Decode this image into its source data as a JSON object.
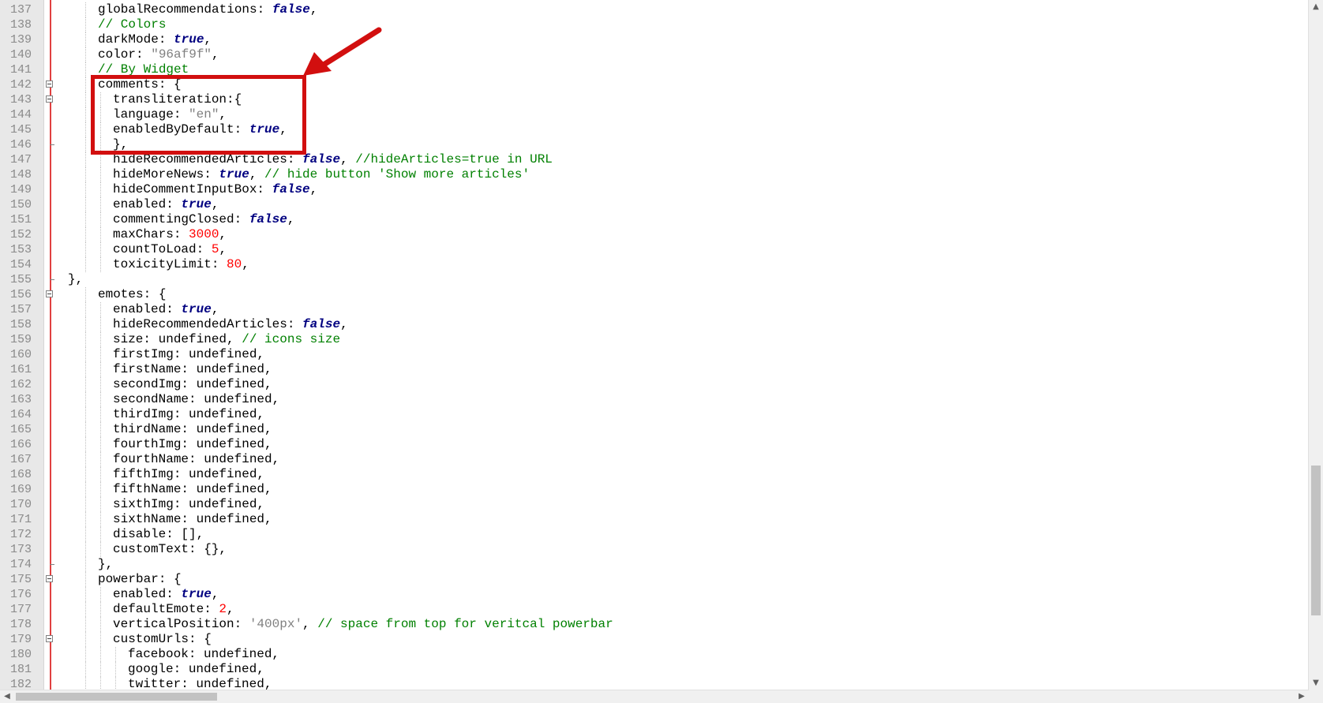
{
  "editor": {
    "colors": {
      "comment": "#008000",
      "keyword": "#000080",
      "string": "#808080",
      "number": "#ff0000",
      "edge_line": "#e04040",
      "highlight_box": "#d20f0f"
    },
    "lines": [
      {
        "num": "137",
        "indent": 2,
        "fold": "",
        "tokens": [
          {
            "t": "globalRecommendations: ",
            "c": "plain"
          },
          {
            "t": "false",
            "c": "kw"
          },
          {
            "t": ",",
            "c": "plain"
          }
        ]
      },
      {
        "num": "138",
        "indent": 2,
        "fold": "",
        "tokens": [
          {
            "t": "// Colors",
            "c": "comment"
          }
        ]
      },
      {
        "num": "139",
        "indent": 2,
        "fold": "",
        "tokens": [
          {
            "t": "darkMode: ",
            "c": "plain"
          },
          {
            "t": "true",
            "c": "kw"
          },
          {
            "t": ",",
            "c": "plain"
          }
        ]
      },
      {
        "num": "140",
        "indent": 2,
        "fold": "",
        "tokens": [
          {
            "t": "color: ",
            "c": "plain"
          },
          {
            "t": "\"96af9f\"",
            "c": "str"
          },
          {
            "t": ",",
            "c": "plain"
          }
        ]
      },
      {
        "num": "141",
        "indent": 2,
        "fold": "",
        "tokens": [
          {
            "t": "// By Widget",
            "c": "comment"
          }
        ]
      },
      {
        "num": "142",
        "indent": 2,
        "fold": "open",
        "tokens": [
          {
            "t": "comments: {",
            "c": "plain"
          }
        ]
      },
      {
        "num": "143",
        "indent": 3,
        "fold": "open",
        "tokens": [
          {
            "t": "transliteration:{",
            "c": "plain"
          }
        ]
      },
      {
        "num": "144",
        "indent": 3,
        "fold": "",
        "tokens": [
          {
            "t": "language: ",
            "c": "plain"
          },
          {
            "t": "\"en\"",
            "c": "str"
          },
          {
            "t": ",",
            "c": "plain"
          }
        ]
      },
      {
        "num": "145",
        "indent": 3,
        "fold": "",
        "tokens": [
          {
            "t": "enabledByDefault: ",
            "c": "plain"
          },
          {
            "t": "true",
            "c": "kw"
          },
          {
            "t": ",",
            "c": "plain"
          }
        ]
      },
      {
        "num": "146",
        "indent": 3,
        "fold": "end",
        "tokens": [
          {
            "t": "},",
            "c": "plain"
          }
        ]
      },
      {
        "num": "147",
        "indent": 3,
        "fold": "",
        "tokens": [
          {
            "t": "hideRecommendedArticles: ",
            "c": "plain"
          },
          {
            "t": "false",
            "c": "kw"
          },
          {
            "t": ", ",
            "c": "plain"
          },
          {
            "t": "//hideArticles=true in URL",
            "c": "comment"
          }
        ]
      },
      {
        "num": "148",
        "indent": 3,
        "fold": "",
        "tokens": [
          {
            "t": "hideMoreNews: ",
            "c": "plain"
          },
          {
            "t": "true",
            "c": "kw"
          },
          {
            "t": ", ",
            "c": "plain"
          },
          {
            "t": "// hide button 'Show more articles'",
            "c": "comment"
          }
        ]
      },
      {
        "num": "149",
        "indent": 3,
        "fold": "",
        "tokens": [
          {
            "t": "hideCommentInputBox: ",
            "c": "plain"
          },
          {
            "t": "false",
            "c": "kw"
          },
          {
            "t": ",",
            "c": "plain"
          }
        ]
      },
      {
        "num": "150",
        "indent": 3,
        "fold": "",
        "tokens": [
          {
            "t": "enabled: ",
            "c": "plain"
          },
          {
            "t": "true",
            "c": "kw"
          },
          {
            "t": ",",
            "c": "plain"
          }
        ]
      },
      {
        "num": "151",
        "indent": 3,
        "fold": "",
        "tokens": [
          {
            "t": "commentingClosed: ",
            "c": "plain"
          },
          {
            "t": "false",
            "c": "kw"
          },
          {
            "t": ",",
            "c": "plain"
          }
        ]
      },
      {
        "num": "152",
        "indent": 3,
        "fold": "",
        "tokens": [
          {
            "t": "maxChars: ",
            "c": "plain"
          },
          {
            "t": "3000",
            "c": "num"
          },
          {
            "t": ",",
            "c": "plain"
          }
        ]
      },
      {
        "num": "153",
        "indent": 3,
        "fold": "",
        "tokens": [
          {
            "t": "countToLoad: ",
            "c": "plain"
          },
          {
            "t": "5",
            "c": "num"
          },
          {
            "t": ",",
            "c": "plain"
          }
        ]
      },
      {
        "num": "154",
        "indent": 3,
        "fold": "",
        "tokens": [
          {
            "t": "toxicityLimit: ",
            "c": "plain"
          },
          {
            "t": "80",
            "c": "num"
          },
          {
            "t": ",",
            "c": "plain"
          }
        ]
      },
      {
        "num": "155",
        "indent": 0,
        "fold": "end",
        "tokens": [
          {
            "t": "},",
            "c": "plain"
          }
        ]
      },
      {
        "num": "156",
        "indent": 2,
        "fold": "open",
        "tokens": [
          {
            "t": "emotes: {",
            "c": "plain"
          }
        ]
      },
      {
        "num": "157",
        "indent": 3,
        "fold": "",
        "tokens": [
          {
            "t": "enabled: ",
            "c": "plain"
          },
          {
            "t": "true",
            "c": "kw"
          },
          {
            "t": ",",
            "c": "plain"
          }
        ]
      },
      {
        "num": "158",
        "indent": 3,
        "fold": "",
        "tokens": [
          {
            "t": "hideRecommendedArticles: ",
            "c": "plain"
          },
          {
            "t": "false",
            "c": "kw"
          },
          {
            "t": ",",
            "c": "plain"
          }
        ]
      },
      {
        "num": "159",
        "indent": 3,
        "fold": "",
        "tokens": [
          {
            "t": "size: undefined, ",
            "c": "plain"
          },
          {
            "t": "// icons size",
            "c": "comment"
          }
        ]
      },
      {
        "num": "160",
        "indent": 3,
        "fold": "",
        "tokens": [
          {
            "t": "firstImg: undefined,",
            "c": "plain"
          }
        ]
      },
      {
        "num": "161",
        "indent": 3,
        "fold": "",
        "tokens": [
          {
            "t": "firstName: undefined,",
            "c": "plain"
          }
        ]
      },
      {
        "num": "162",
        "indent": 3,
        "fold": "",
        "tokens": [
          {
            "t": "secondImg: undefined,",
            "c": "plain"
          }
        ]
      },
      {
        "num": "163",
        "indent": 3,
        "fold": "",
        "tokens": [
          {
            "t": "secondName: undefined,",
            "c": "plain"
          }
        ]
      },
      {
        "num": "164",
        "indent": 3,
        "fold": "",
        "tokens": [
          {
            "t": "thirdImg: undefined,",
            "c": "plain"
          }
        ]
      },
      {
        "num": "165",
        "indent": 3,
        "fold": "",
        "tokens": [
          {
            "t": "thirdName: undefined,",
            "c": "plain"
          }
        ]
      },
      {
        "num": "166",
        "indent": 3,
        "fold": "",
        "tokens": [
          {
            "t": "fourthImg: undefined,",
            "c": "plain"
          }
        ]
      },
      {
        "num": "167",
        "indent": 3,
        "fold": "",
        "tokens": [
          {
            "t": "fourthName: undefined,",
            "c": "plain"
          }
        ]
      },
      {
        "num": "168",
        "indent": 3,
        "fold": "",
        "tokens": [
          {
            "t": "fifthImg: undefined,",
            "c": "plain"
          }
        ]
      },
      {
        "num": "169",
        "indent": 3,
        "fold": "",
        "tokens": [
          {
            "t": "fifthName: undefined,",
            "c": "plain"
          }
        ]
      },
      {
        "num": "170",
        "indent": 3,
        "fold": "",
        "tokens": [
          {
            "t": "sixthImg: undefined,",
            "c": "plain"
          }
        ]
      },
      {
        "num": "171",
        "indent": 3,
        "fold": "",
        "tokens": [
          {
            "t": "sixthName: undefined,",
            "c": "plain"
          }
        ]
      },
      {
        "num": "172",
        "indent": 3,
        "fold": "",
        "tokens": [
          {
            "t": "disable: [],",
            "c": "plain"
          }
        ]
      },
      {
        "num": "173",
        "indent": 3,
        "fold": "",
        "tokens": [
          {
            "t": "customText: {},",
            "c": "plain"
          }
        ]
      },
      {
        "num": "174",
        "indent": 2,
        "fold": "end",
        "tokens": [
          {
            "t": "},",
            "c": "plain"
          }
        ]
      },
      {
        "num": "175",
        "indent": 2,
        "fold": "open",
        "tokens": [
          {
            "t": "powerbar: {",
            "c": "plain"
          }
        ]
      },
      {
        "num": "176",
        "indent": 3,
        "fold": "",
        "tokens": [
          {
            "t": "enabled: ",
            "c": "plain"
          },
          {
            "t": "true",
            "c": "kw"
          },
          {
            "t": ",",
            "c": "plain"
          }
        ]
      },
      {
        "num": "177",
        "indent": 3,
        "fold": "",
        "tokens": [
          {
            "t": "defaultEmote: ",
            "c": "plain"
          },
          {
            "t": "2",
            "c": "num"
          },
          {
            "t": ",",
            "c": "plain"
          }
        ]
      },
      {
        "num": "178",
        "indent": 3,
        "fold": "",
        "tokens": [
          {
            "t": "verticalPosition: ",
            "c": "plain"
          },
          {
            "t": "'400px'",
            "c": "str"
          },
          {
            "t": ", ",
            "c": "plain"
          },
          {
            "t": "// space from top for veritcal powerbar",
            "c": "comment"
          }
        ]
      },
      {
        "num": "179",
        "indent": 3,
        "fold": "open",
        "tokens": [
          {
            "t": "customUrls: {",
            "c": "plain"
          }
        ]
      },
      {
        "num": "180",
        "indent": 4,
        "fold": "",
        "tokens": [
          {
            "t": "facebook: undefined,",
            "c": "plain"
          }
        ]
      },
      {
        "num": "181",
        "indent": 4,
        "fold": "",
        "tokens": [
          {
            "t": "google: undefined,",
            "c": "plain"
          }
        ]
      },
      {
        "num": "182",
        "indent": 4,
        "fold": "",
        "tokens": [
          {
            "t": "twitter: undefined,",
            "c": "plain"
          }
        ]
      }
    ]
  },
  "scrollbars": {
    "up_icon": "▲",
    "down_icon": "▼",
    "left_icon": "◀",
    "right_icon": "▶"
  }
}
